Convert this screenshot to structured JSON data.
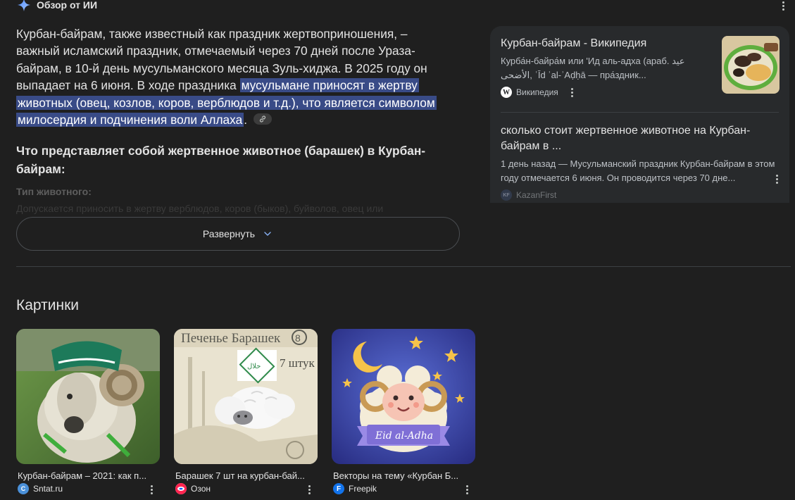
{
  "ai_overview": {
    "title": "Обзор от ИИ",
    "para_start": "Курбан-байрам, также известный как праздник жертвоприношения, – важный исламский праздник, отмечаемый через 70 дней после Ураза-байрам, в 10-й день мусульманского месяца Зуль-хиджа. В 2025 году он выпадает на 6 июня. В ходе праздника ",
    "para_highlight": "мусульмане приносят в жертву животных (овец, козлов, коров, верблюдов и т.д.), что является символом милосердия и подчинения воли Аллаха",
    "para_end": ".",
    "question": "Что представляет собой жертвенное животное (барашек) в Курбан-байрам:",
    "faded_heading": "Тип животного:",
    "faded_text": "Допускается приносить в жертву верблюдов, коров (быков), буйволов, овец или",
    "expand_label": "Развернуть"
  },
  "sources": [
    {
      "title": "Курбан-байрам - Википедия",
      "snippet": "Курба́н-байра́м или 'Ид аль-адха (араб. عيد الأضحى‎, ʿĪd ʾal-ʾAḍḥā — пра́здник...",
      "site": "Википедия",
      "favicon_letter": "W"
    },
    {
      "title": "сколько стоит жертвенное животное на Курбан-байрам в ...",
      "snippet": "1 день назад — Мусульманский праздник Курбан-байрам в этом году отмечается 6 июня. Он проводится через 70 дне...",
      "site": "KazanFirst",
      "favicon_letter": "KF"
    }
  ],
  "images": {
    "title": "Картинки",
    "items": [
      {
        "caption": "Курбан-байрам – 2021: как п...",
        "site": "Sntat.ru",
        "fav_color": "#4a90d9"
      },
      {
        "caption": "Барашек 7 шт на курбан-бай...",
        "site": "Озон",
        "fav_color": "#ff3344"
      },
      {
        "caption": "Векторы на тему «Курбан Б...",
        "site": "Freepik",
        "fav_color": "#1273eb"
      }
    ],
    "picture_texts": {
      "cookie_pack": "Печенье Барашек",
      "cookie_count": "7 штук",
      "halal": "حلال",
      "eid": "Eid al-Adha"
    }
  },
  "colors": {
    "background": "#1f1f1f",
    "highlight": "#394b87",
    "panel": "#282a2c"
  }
}
